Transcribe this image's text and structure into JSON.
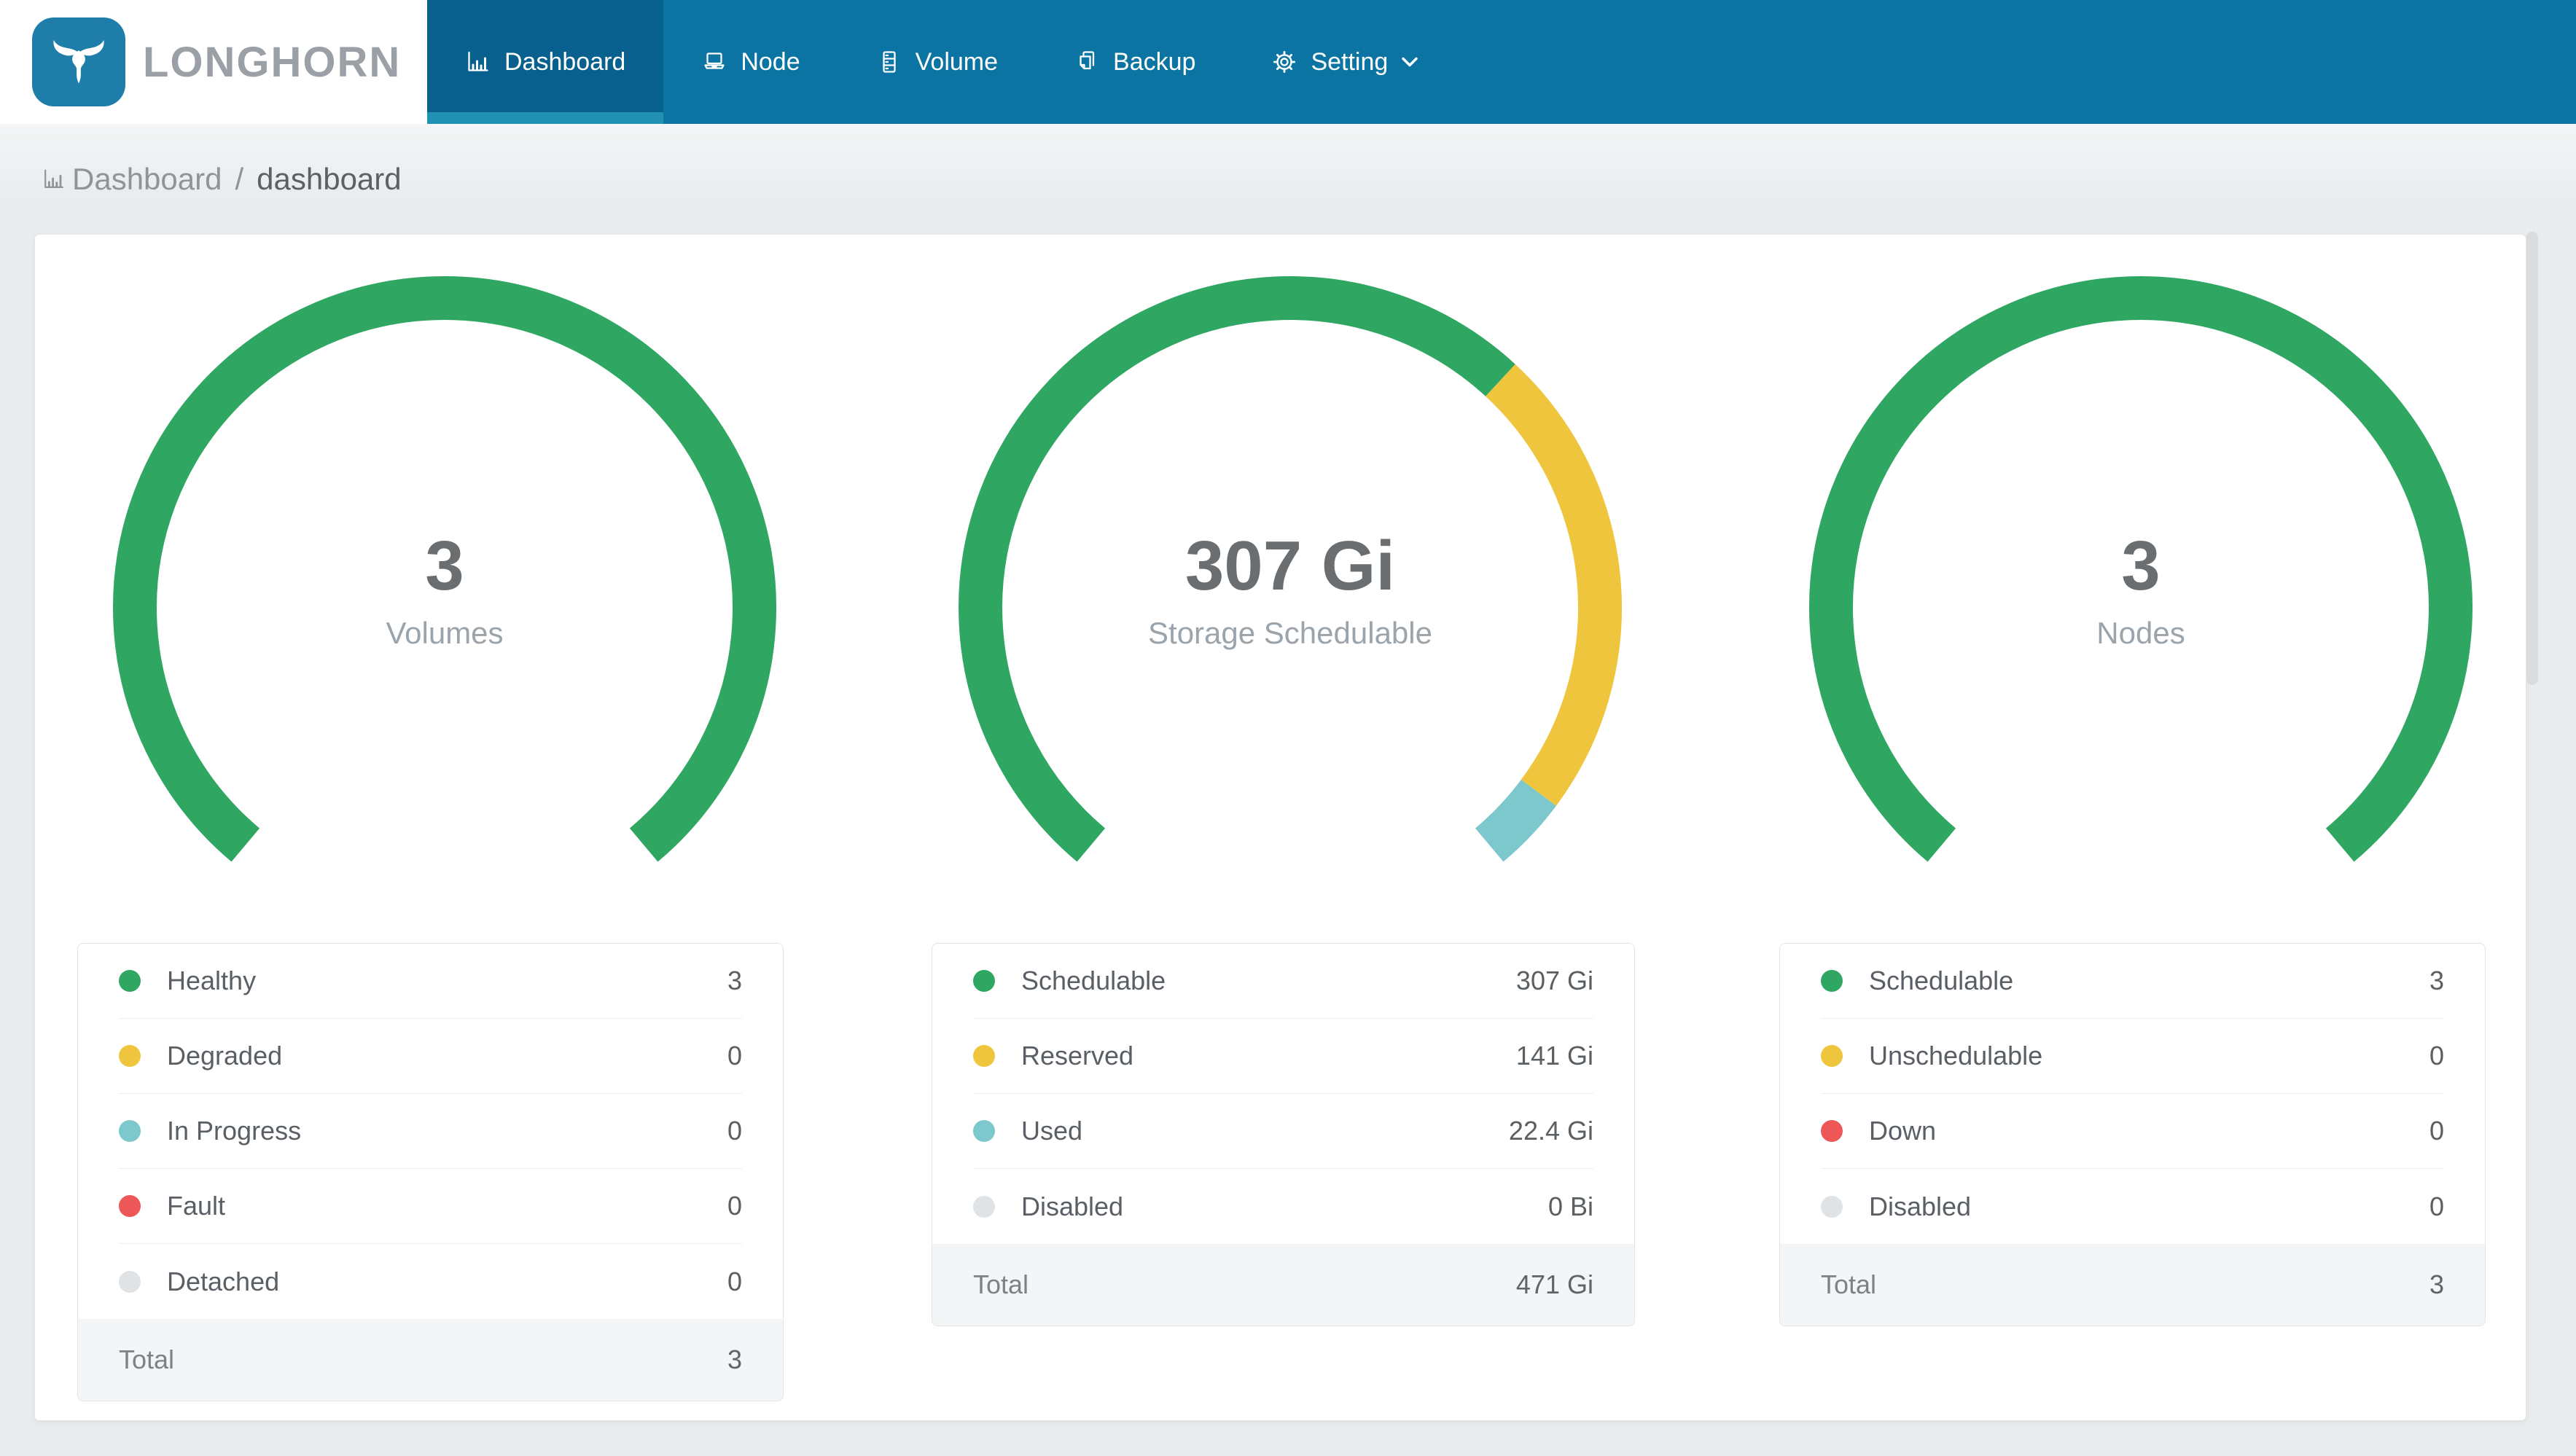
{
  "header": {
    "brand": "LONGHORN",
    "nav": [
      {
        "label": "Dashboard",
        "icon": "bar-chart-icon",
        "active": true
      },
      {
        "label": "Node",
        "icon": "laptop-icon",
        "active": false
      },
      {
        "label": "Volume",
        "icon": "server-icon",
        "active": false
      },
      {
        "label": "Backup",
        "icon": "copy-icon",
        "active": false
      },
      {
        "label": "Setting",
        "icon": "gear-icon",
        "active": false,
        "has_dropdown": true,
        "dropdown_icon": "chevron-down-icon"
      }
    ]
  },
  "breadcrumb": {
    "section": "Dashboard",
    "separator": "/",
    "page": "dashboard",
    "icon": "bar-chart-icon"
  },
  "colors": {
    "green": "#2fa762",
    "yellow": "#f0c53e",
    "teal": "#7cc8cd",
    "red": "#ee5758",
    "gray": "#e0e3e6",
    "nav_bg": "#0b74a2",
    "nav_active_bg": "#07608e",
    "nav_active_underline": "#2191b2",
    "logo_bg": "#1e7ea9",
    "brand_text": "#9aa0a5",
    "page_bg": "#e9eced",
    "value_text": "#6b6e70",
    "sublabel_text": "#9ba3ab"
  },
  "chart_data": [
    {
      "type": "gauge",
      "name": "volumes",
      "center_value": "3",
      "center_label": "Volumes",
      "sweep_deg": 280,
      "start_bearing_deg": 220,
      "segments": [
        {
          "label": "Healthy",
          "value": 3,
          "display": "3",
          "color": "green"
        },
        {
          "label": "Degraded",
          "value": 0,
          "display": "0",
          "color": "yellow"
        },
        {
          "label": "In Progress",
          "value": 0,
          "display": "0",
          "color": "teal"
        },
        {
          "label": "Fault",
          "value": 0,
          "display": "0",
          "color": "red"
        },
        {
          "label": "Detached",
          "value": 0,
          "display": "0",
          "color": "gray"
        }
      ],
      "total_label": "Total",
      "total_display": "3"
    },
    {
      "type": "gauge",
      "name": "storage-schedulable",
      "center_value": "307 Gi",
      "center_label": "Storage Schedulable",
      "sweep_deg": 280,
      "start_bearing_deg": 220,
      "segments": [
        {
          "label": "Schedulable",
          "value": 307,
          "display": "307 Gi",
          "color": "green"
        },
        {
          "label": "Reserved",
          "value": 141,
          "display": "141 Gi",
          "color": "yellow"
        },
        {
          "label": "Used",
          "value": 22.4,
          "display": "22.4 Gi",
          "color": "teal"
        },
        {
          "label": "Disabled",
          "value": 0,
          "display": "0 Bi",
          "color": "gray"
        }
      ],
      "total_label": "Total",
      "total_display": "471 Gi"
    },
    {
      "type": "gauge",
      "name": "nodes",
      "center_value": "3",
      "center_label": "Nodes",
      "sweep_deg": 280,
      "start_bearing_deg": 220,
      "segments": [
        {
          "label": "Schedulable",
          "value": 3,
          "display": "3",
          "color": "green"
        },
        {
          "label": "Unschedulable",
          "value": 0,
          "display": "0",
          "color": "yellow"
        },
        {
          "label": "Down",
          "value": 0,
          "display": "0",
          "color": "red"
        },
        {
          "label": "Disabled",
          "value": 0,
          "display": "0",
          "color": "gray"
        }
      ],
      "total_label": "Total",
      "total_display": "3"
    }
  ]
}
